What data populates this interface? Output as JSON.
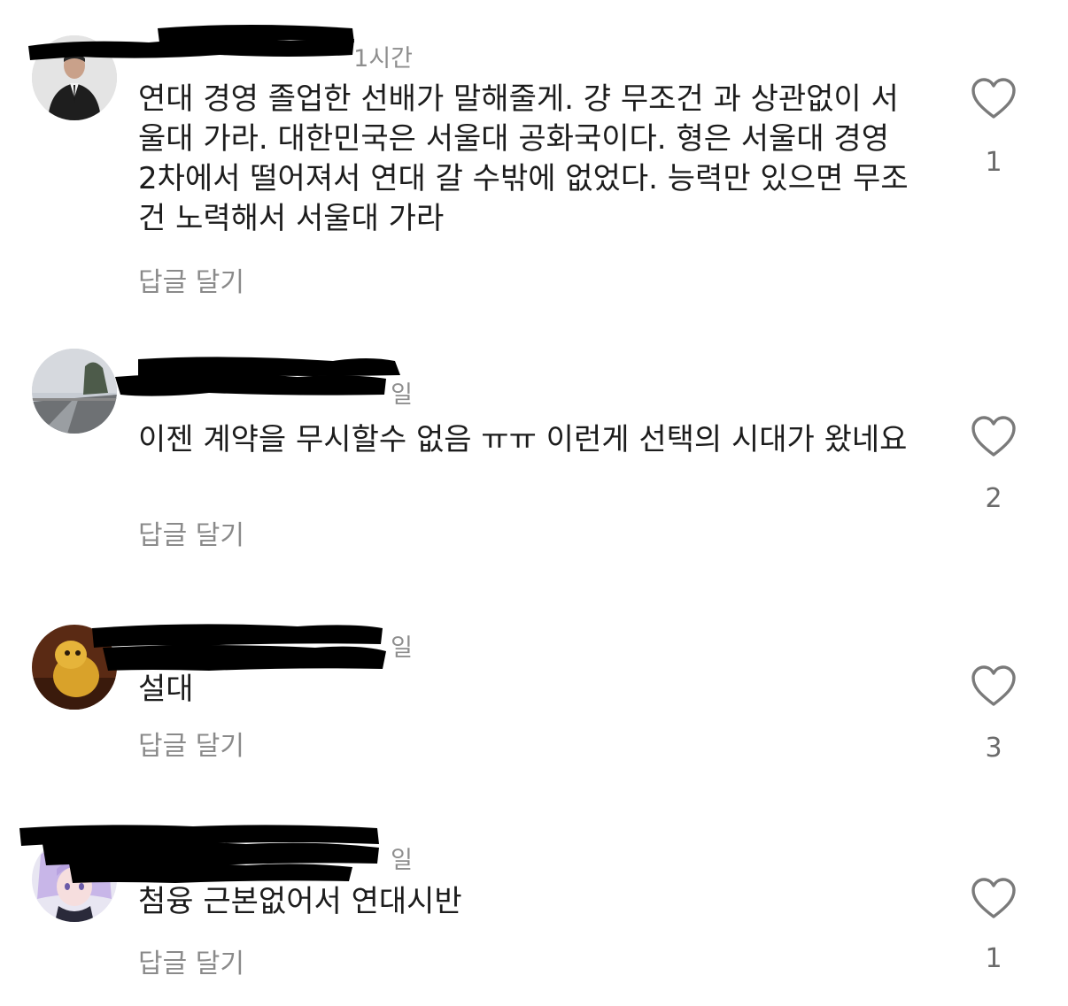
{
  "comments": [
    {
      "time": "1시간",
      "text": "연대 경영 졸업한 선배가 말해줄게. 걍 무조건 과 상관없이 서울대 가라. 대한민국은 서울대 공화국이다. 형은 서울대 경영 2차에서 떨어져서 연대 갈 수밖에 없었다. 능력만 있으면 무조건 노력해서 서울대 가라",
      "reply_label": "답글 달기",
      "like_count": "1",
      "avatar_icon": "person-in-suit-avatar"
    },
    {
      "time": "일",
      "text": "이젠 계약을 무시할수 없음 ㅠㅠ 이런게 선택의 시대가 왔네요",
      "reply_label": "답글 달기",
      "like_count": "2",
      "avatar_icon": "road-landscape-avatar"
    },
    {
      "time": "일",
      "text": "설대",
      "reply_label": "답글 달기",
      "like_count": "3",
      "avatar_icon": "yellow-character-avatar"
    },
    {
      "time": "일",
      "text": "첨융 근본없어서 연대시반",
      "reply_label": "답글 달기",
      "like_count": "1",
      "avatar_icon": "anime-girl-avatar"
    }
  ],
  "colors": {
    "text": "#1c1c1c",
    "meta": "#8e8e8e",
    "reply": "#8a8a8a",
    "heart": "#7a7a7a",
    "redaction": "#000000"
  }
}
